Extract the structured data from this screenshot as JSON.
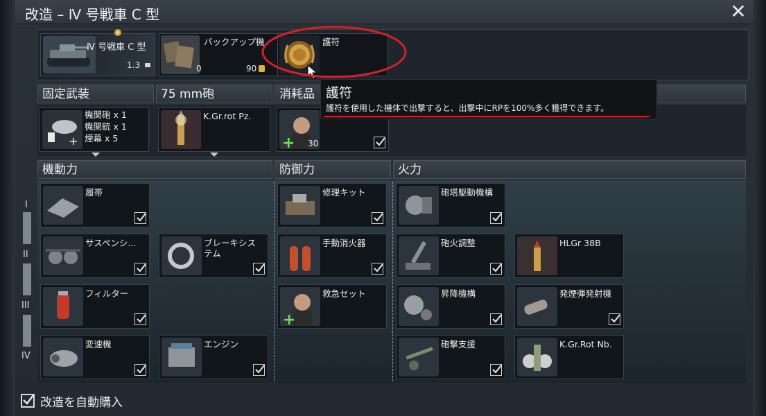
{
  "window": {
    "title": "改造 – Ⅳ 号戦車 C 型"
  },
  "top": {
    "vehicle": {
      "name": "Ⅳ 号戦車 C 型",
      "rating": "1.3"
    },
    "backup": {
      "label": "バックアップ機",
      "count": "0",
      "price": "90"
    },
    "talisman": {
      "label": "護符"
    }
  },
  "sections": {
    "fixed": "固定武装",
    "gun": "75 mm砲",
    "consumable": "消耗品",
    "mobility": "機動力",
    "protection": "防御力",
    "firepower": "火力"
  },
  "fixed_weapons": [
    "機関砲 x 1",
    "機関銃 x 1",
    "煙幕 x 5"
  ],
  "ammo": {
    "name": "K.Gr.rot Pz."
  },
  "crew": {
    "count": "30"
  },
  "tooltip": {
    "title": "護符",
    "text": "護符を使用した機体で出撃すると、出撃中にRPを100%多く獲得できます。"
  },
  "tiers": [
    "I",
    "II",
    "III",
    "IV"
  ],
  "modules": {
    "mobility": [
      "履帯",
      "サスペンシ...",
      "ブレーキシステム",
      "フィルター",
      "変速機",
      "エンジン"
    ],
    "protection": [
      "修理キット",
      "手動消火器",
      "救急セット"
    ],
    "firepower": [
      "砲塔駆動機構",
      "砲火調整",
      "HLGr 38B",
      "昇降機構",
      "発煙弾発射機",
      "砲撃支援",
      "K.Gr.Rot Nb."
    ]
  },
  "footer": {
    "auto_buy": "改造を自動購入"
  },
  "colors": {
    "accent_red": "#d61f2a",
    "panel": "#1e252c",
    "section_header": "#3b434b"
  }
}
